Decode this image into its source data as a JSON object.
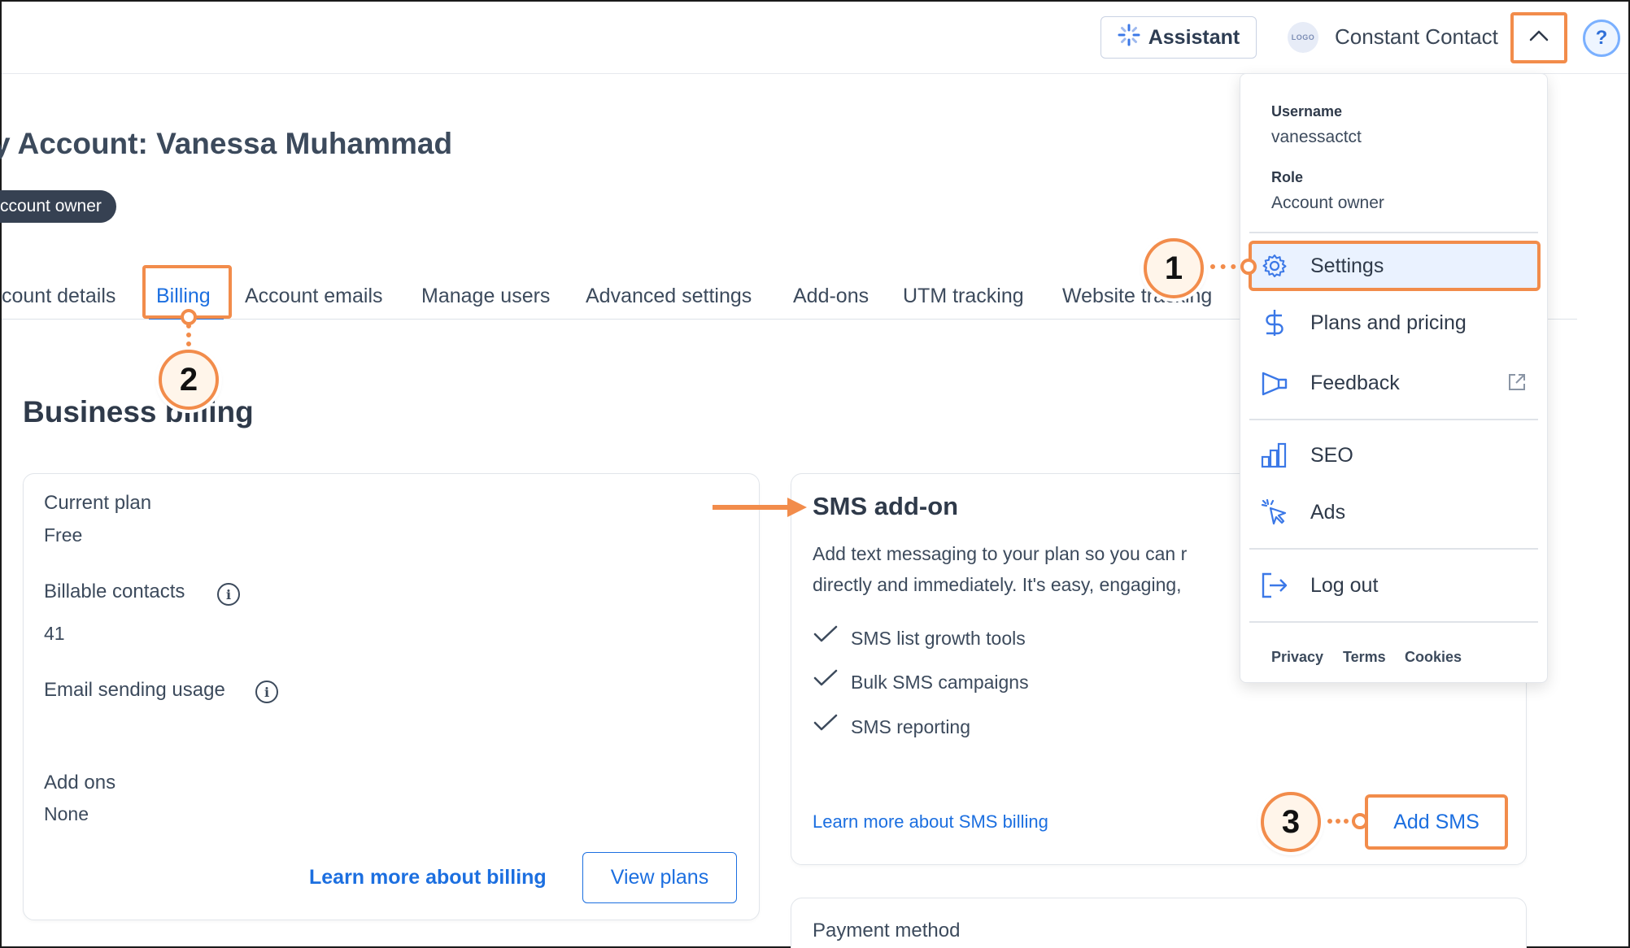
{
  "topbar": {
    "assistant_label": "Assistant",
    "logo_text": "LOGO",
    "brand_name": "Constant Contact",
    "help_symbol": "?"
  },
  "header": {
    "title": "y Account: Vanessa Muhammad",
    "role_badge": "ccount owner"
  },
  "tabs": [
    {
      "label": "count details"
    },
    {
      "label": "Billing",
      "active": true
    },
    {
      "label": "Account emails"
    },
    {
      "label": "Manage users"
    },
    {
      "label": "Advanced settings"
    },
    {
      "label": "Add-ons"
    },
    {
      "label": "UTM tracking"
    },
    {
      "label": "Website tracking"
    }
  ],
  "section_title": "Business billing",
  "plan_card": {
    "current_plan_label": "Current plan",
    "current_plan_value": "Free",
    "billable_contacts_label": "Billable contacts",
    "billable_contacts_value": "41",
    "email_usage_label": "Email sending usage",
    "add_ons_label": "Add ons",
    "add_ons_value": "None",
    "learn_more_link": "Learn more about billing",
    "view_plans_button": "View plans"
  },
  "sms_card": {
    "title": "SMS add-on",
    "description_line1": "Add text messaging to your plan so you can r",
    "description_line2": "directly and immediately. It's easy, engaging,",
    "features": [
      "SMS list growth tools",
      "Bulk SMS campaigns",
      "SMS reporting"
    ],
    "learn_more_link": "Learn more about SMS billing",
    "add_button": "Add SMS"
  },
  "payment_card": {
    "title": "Payment method"
  },
  "dropdown": {
    "username_label": "Username",
    "username_value": "vanessactct",
    "role_label": "Role",
    "role_value": "Account owner",
    "items": [
      {
        "label": "Settings",
        "icon": "gear-icon"
      },
      {
        "label": "Plans and pricing",
        "icon": "dollar-icon"
      },
      {
        "label": "Feedback",
        "icon": "megaphone-icon"
      },
      {
        "label": "SEO",
        "icon": "bar-chart-icon"
      },
      {
        "label": "Ads",
        "icon": "cursor-click-icon"
      },
      {
        "label": "Log out",
        "icon": "logout-icon"
      }
    ],
    "footer_links": [
      "Privacy",
      "Terms",
      "Cookies"
    ]
  },
  "callouts": [
    "1",
    "2",
    "3"
  ],
  "colors": {
    "accent": "#1c6fe0",
    "highlight": "#f28c4b",
    "text": "#3c4a5c"
  }
}
